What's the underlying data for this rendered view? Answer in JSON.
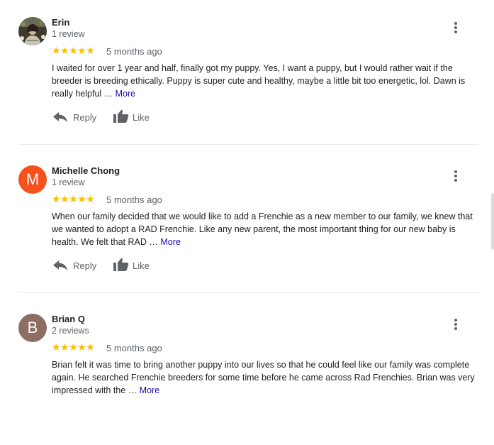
{
  "reviews": [
    {
      "name": "Erin",
      "count": "1 review",
      "stars": "★★★★★",
      "date": "5 months ago",
      "text": "I waited for over 1 year and half, finally got my puppy. Yes, I want a puppy, but I would rather wait if the breeder is breeding ethically. Puppy is super cute and healthy, maybe a little bit too energetic, lol. Dawn is really helpful …",
      "more": "More",
      "reply": "Reply",
      "like": "Like",
      "avatar_type": "photo"
    },
    {
      "name": "Michelle Chong",
      "count": "1 review",
      "stars": "★★★★★",
      "date": "5 months ago",
      "text": "When our family decided that we would like to add a Frenchie as a new member to our family, we knew that we wanted to adopt a RAD Frenchie. Like any new parent, the most important thing for our new baby is health. We felt that RAD …",
      "more": "More",
      "reply": "Reply",
      "like": "Like",
      "avatar_initial": "M",
      "avatar_color": "#f4511e"
    },
    {
      "name": "Brian Q",
      "count": "2 reviews",
      "stars": "★★★★★",
      "date": "5 months ago",
      "text": "Brian felt it was time to bring another puppy into our lives so that he could feel like our family was complete again. He searched Frenchie  breeders  for some time before he came across Rad Frenchies. Brian was very impressed with the …",
      "more": "More",
      "reply": "Reply",
      "like": "Like",
      "avatar_initial": "B",
      "avatar_color": "#8d6e63"
    }
  ],
  "icons": {
    "star_color": "#fbbc04",
    "reply_icon": "reply-arrow-icon",
    "like_icon": "thumbs-up-icon",
    "menu_icon": "more-vert-icon"
  }
}
